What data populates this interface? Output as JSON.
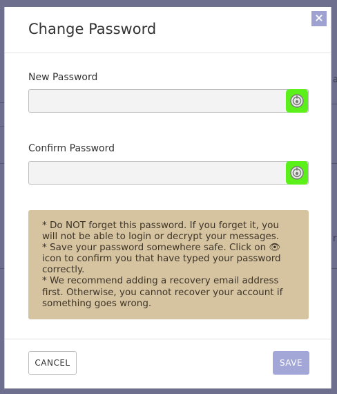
{
  "dialog": {
    "title": "Change Password",
    "close_icon": "×"
  },
  "fields": [
    {
      "label": "New Password",
      "value": "",
      "placeholder": ""
    },
    {
      "label": "Confirm Password",
      "value": "",
      "placeholder": ""
    }
  ],
  "notice": {
    "lines": [
      "* Do NOT forget this password. If you forget it, you will not be able to login or decrypt your messages.",
      "* Save your password somewhere safe. Click on 👁 icon to confirm you that have typed your password correctly.",
      "* We recommend adding a recovery email address first. Otherwise, you cannot recover your account if something goes wrong."
    ]
  },
  "buttons": {
    "cancel_label": "CANCEL",
    "save_label": "SAVE"
  },
  "background": {
    "partial_text_right": "a",
    "partial_text_right_2": "r"
  },
  "colors": {
    "overlay": "#6e6e8e",
    "accent": "#a3a7d7",
    "eye_toggle": "#5cf01a",
    "notice_bg": "#d6c3a0"
  }
}
